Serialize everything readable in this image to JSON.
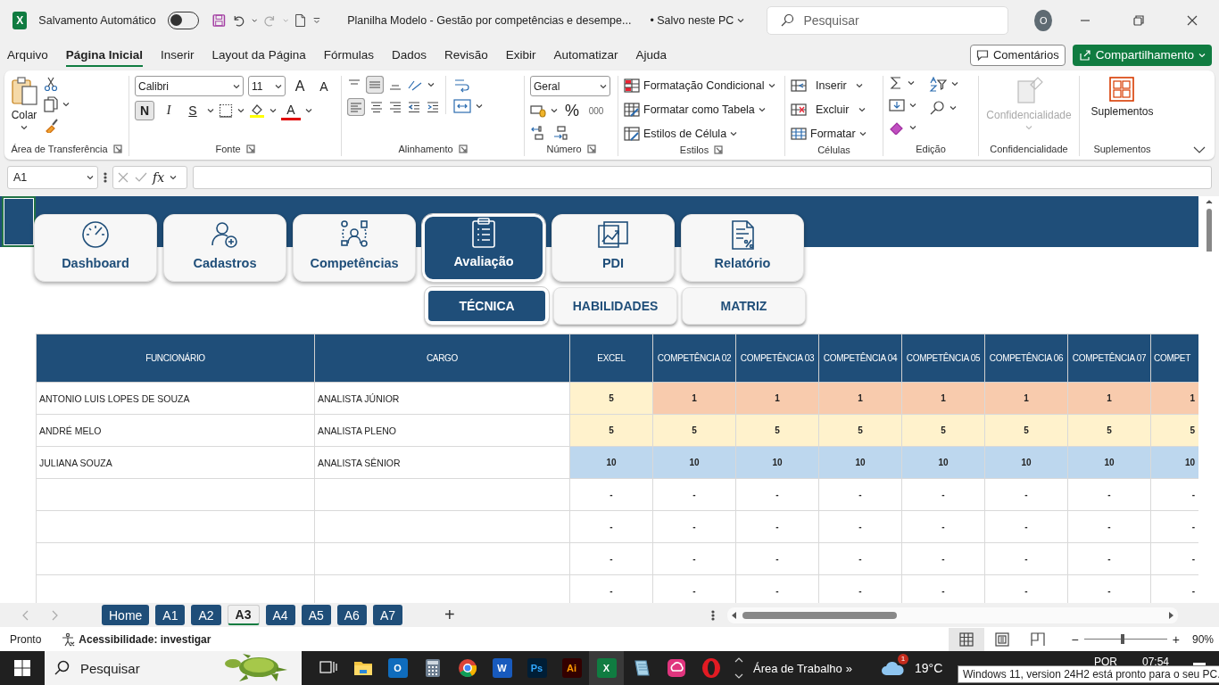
{
  "titlebar": {
    "app_glyph": "X",
    "autosave_label": "Salvamento Automático",
    "autosave_on": false,
    "title": "Planilha Modelo - Gestão por competências e desempe...",
    "save_state": "• Salvo neste PC",
    "search_placeholder": "Pesquisar",
    "avatar": "O"
  },
  "menu_tabs": [
    {
      "label": "Arquivo",
      "selected": false
    },
    {
      "label": "Página Inicial",
      "selected": true
    },
    {
      "label": "Inserir",
      "selected": false
    },
    {
      "label": "Layout da Página",
      "selected": false
    },
    {
      "label": "Fórmulas",
      "selected": false
    },
    {
      "label": "Dados",
      "selected": false
    },
    {
      "label": "Revisão",
      "selected": false
    },
    {
      "label": "Exibir",
      "selected": false
    },
    {
      "label": "Automatizar",
      "selected": false
    },
    {
      "label": "Ajuda",
      "selected": false
    }
  ],
  "actions": {
    "comments": "Comentários",
    "share": "Compartilhamento"
  },
  "ribbon": [
    {
      "kind": "clipboard",
      "label": "Área de Transferência",
      "paste": "Colar"
    },
    {
      "kind": "font",
      "label": "Fonte",
      "font_name": "Calibri",
      "font_size": "11",
      "grow": "A",
      "shrink": "A",
      "bold": "N",
      "italic": "I",
      "underline": "S",
      "font_color": "A"
    },
    {
      "kind": "alignment",
      "label": "Alinhamento"
    },
    {
      "kind": "number",
      "label": "Número",
      "format": "Geral",
      "percent": "%",
      "thousands": "000"
    },
    {
      "kind": "styles",
      "label": "Estilos",
      "items": [
        "Formatação Condicional",
        "Formatar como Tabela",
        "Estilos de Célula"
      ]
    },
    {
      "kind": "cells",
      "label": "Células",
      "items": [
        "Inserir",
        "Excluir",
        "Formatar"
      ]
    },
    {
      "kind": "editing",
      "label": "Edição"
    },
    {
      "kind": "sensitivity",
      "label": "Confidencialidade",
      "button": "Confidencialidade",
      "disabled": true
    },
    {
      "kind": "addins",
      "label": "Suplementos",
      "button": "Suplementos"
    }
  ],
  "formula_bar": {
    "name_box": "A1",
    "fx": "fx"
  },
  "nav_buttons": [
    {
      "label": "Dashboard",
      "selected": false
    },
    {
      "label": "Cadastros",
      "selected": false
    },
    {
      "label": "Competências",
      "selected": false
    },
    {
      "label": "Avaliação",
      "selected": true
    },
    {
      "label": "PDI",
      "selected": false
    },
    {
      "label": "Relatório",
      "selected": false
    }
  ],
  "sub_tabs": [
    {
      "label": "TÉCNICA",
      "selected": true
    },
    {
      "label": "HABILIDADES",
      "selected": false
    },
    {
      "label": "MATRIZ",
      "selected": false
    }
  ],
  "table": {
    "columns": [
      "FUNCIONÁRIO",
      "CARGO",
      "EXCEL",
      "COMPETÊNCIA 02",
      "COMPETÊNCIA 03",
      "COMPETÊNCIA 04",
      "COMPETÊNCIA 05",
      "COMPETÊNCIA 06",
      "COMPETÊNCIA 07",
      "COMPET"
    ],
    "rows": [
      {
        "name": "ANTONIO LUIS LOPES DE SOUZA",
        "role": "ANALISTA JÚNIOR",
        "scores": [
          {
            "value": "5",
            "color": "#fff2cc"
          },
          {
            "value": "1",
            "color": "#f8cbad"
          },
          {
            "value": "1",
            "color": "#f8cbad"
          },
          {
            "value": "1",
            "color": "#f8cbad"
          },
          {
            "value": "1",
            "color": "#f8cbad"
          },
          {
            "value": "1",
            "color": "#f8cbad"
          },
          {
            "value": "1",
            "color": "#f8cbad"
          },
          {
            "value": "1",
            "color": "#f8cbad"
          }
        ]
      },
      {
        "name": "ANDRÉ MELO",
        "role": "ANALISTA PLENO",
        "scores": [
          {
            "value": "5",
            "color": "#fff2cc"
          },
          {
            "value": "5",
            "color": "#fff2cc"
          },
          {
            "value": "5",
            "color": "#fff2cc"
          },
          {
            "value": "5",
            "color": "#fff2cc"
          },
          {
            "value": "5",
            "color": "#fff2cc"
          },
          {
            "value": "5",
            "color": "#fff2cc"
          },
          {
            "value": "5",
            "color": "#fff2cc"
          },
          {
            "value": "5",
            "color": "#fff2cc"
          }
        ]
      },
      {
        "name": "JULIANA SOUZA",
        "role": "ANALISTA SÊNIOR",
        "scores": [
          {
            "value": "10",
            "color": "#bdd7ee"
          },
          {
            "value": "10",
            "color": "#bdd7ee"
          },
          {
            "value": "10",
            "color": "#bdd7ee"
          },
          {
            "value": "10",
            "color": "#bdd7ee"
          },
          {
            "value": "10",
            "color": "#bdd7ee"
          },
          {
            "value": "10",
            "color": "#bdd7ee"
          },
          {
            "value": "10",
            "color": "#bdd7ee"
          },
          {
            "value": "10",
            "color": "#bdd7ee"
          }
        ]
      },
      {
        "scores": [
          {
            "value": "-"
          },
          {
            "value": "-"
          },
          {
            "value": "-"
          },
          {
            "value": "-"
          },
          {
            "value": "-"
          },
          {
            "value": "-"
          },
          {
            "value": "-"
          },
          {
            "value": "-"
          }
        ]
      },
      {
        "scores": [
          {
            "value": "-"
          },
          {
            "value": "-"
          },
          {
            "value": "-"
          },
          {
            "value": "-"
          },
          {
            "value": "-"
          },
          {
            "value": "-"
          },
          {
            "value": "-"
          },
          {
            "value": "-"
          }
        ]
      },
      {
        "scores": [
          {
            "value": "-"
          },
          {
            "value": "-"
          },
          {
            "value": "-"
          },
          {
            "value": "-"
          },
          {
            "value": "-"
          },
          {
            "value": "-"
          },
          {
            "value": "-"
          },
          {
            "value": "-"
          }
        ]
      },
      {
        "scores": [
          {
            "value": "-"
          },
          {
            "value": "-"
          },
          {
            "value": "-"
          },
          {
            "value": "-"
          },
          {
            "value": "-"
          },
          {
            "value": "-"
          },
          {
            "value": "-"
          },
          {
            "value": "-"
          }
        ]
      }
    ]
  },
  "sheet_tabs": [
    {
      "label": "Home",
      "selected": false
    },
    {
      "label": "A1",
      "selected": false
    },
    {
      "label": "A2",
      "selected": false
    },
    {
      "label": "A3",
      "selected": true
    },
    {
      "label": "A4",
      "selected": false
    },
    {
      "label": "A5",
      "selected": false
    },
    {
      "label": "A6",
      "selected": false
    },
    {
      "label": "A7",
      "selected": false
    }
  ],
  "add_sheet": "+",
  "status_bar": {
    "ready": "Pronto",
    "accessibility": "Acessibilidade: investigar",
    "views": [
      {
        "kind": "normal",
        "selected": true
      },
      {
        "kind": "layout",
        "selected": false
      },
      {
        "kind": "pagebreak",
        "selected": false
      }
    ],
    "zoom_minus": "−",
    "zoom_plus": "+",
    "zoom_slider": {
      "level": 0.47
    },
    "zoom": "90%"
  },
  "taskbar": {
    "search": "Pesquisar",
    "apps": [
      {
        "kind": "taskview",
        "selected": false
      },
      {
        "kind": "explorer",
        "selected": false
      },
      {
        "kind": "outlook",
        "glyph": "O",
        "selected": false
      },
      {
        "kind": "calculator",
        "selected": false
      },
      {
        "kind": "chrome",
        "selected": false
      },
      {
        "kind": "word",
        "glyph": "W",
        "selected": false
      },
      {
        "kind": "photoshop",
        "glyph": "Ps",
        "selected": false
      },
      {
        "kind": "illustrator",
        "glyph": "Ai",
        "selected": false
      },
      {
        "kind": "excel",
        "glyph": "X",
        "selected": true
      },
      {
        "kind": "notepad",
        "selected": false
      },
      {
        "kind": "creative",
        "selected": false
      },
      {
        "kind": "opera",
        "selected": false
      }
    ],
    "desktop": "Área de Trabalho",
    "desktop_chevron": "»",
    "weather_badge": "1",
    "temperature": "19°C",
    "language": "POR",
    "time": "07:54",
    "tooltip": "Windows 11, version 24H2 está pronto para o seu PC."
  }
}
